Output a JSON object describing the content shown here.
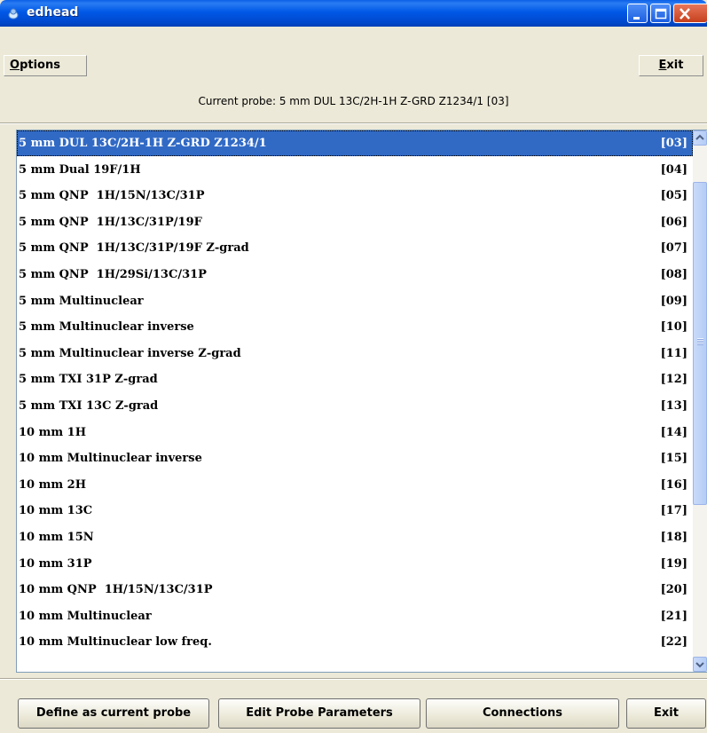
{
  "window": {
    "title": "edhead"
  },
  "menu": {
    "options_label": "Options",
    "exit_label": "Exit"
  },
  "info": {
    "current_probe_text": "Current probe: 5 mm DUL 13C/2H-1H Z-GRD Z1234/1 [03]"
  },
  "list": {
    "selected_index": 0,
    "items": [
      {
        "label": "5 mm DUL 13C/2H-1H Z-GRD Z1234/1",
        "code": "[03]"
      },
      {
        "label": "5 mm Dual 19F/1H",
        "code": "[04]"
      },
      {
        "label": "5 mm QNP  1H/15N/13C/31P",
        "code": "[05]"
      },
      {
        "label": "5 mm QNP  1H/13C/31P/19F",
        "code": "[06]"
      },
      {
        "label": "5 mm QNP  1H/13C/31P/19F Z-grad",
        "code": "[07]"
      },
      {
        "label": "5 mm QNP  1H/29Si/13C/31P",
        "code": "[08]"
      },
      {
        "label": "5 mm Multinuclear",
        "code": "[09]"
      },
      {
        "label": "5 mm Multinuclear inverse",
        "code": "[10]"
      },
      {
        "label": "5 mm Multinuclear inverse Z-grad",
        "code": "[11]"
      },
      {
        "label": "5 mm TXI 31P Z-grad",
        "code": "[12]"
      },
      {
        "label": "5 mm TXI 13C Z-grad",
        "code": "[13]"
      },
      {
        "label": "10 mm 1H",
        "code": "[14]"
      },
      {
        "label": "10 mm Multinuclear inverse",
        "code": "[15]"
      },
      {
        "label": "10 mm 2H",
        "code": "[16]"
      },
      {
        "label": "10 mm 13C",
        "code": "[17]"
      },
      {
        "label": "10 mm 15N",
        "code": "[18]"
      },
      {
        "label": "10 mm 31P",
        "code": "[19]"
      },
      {
        "label": "10 mm QNP  1H/15N/13C/31P",
        "code": "[20]"
      },
      {
        "label": "10 mm Multinuclear",
        "code": "[21]"
      },
      {
        "label": "10 mm Multinuclear low freq.",
        "code": "[22]"
      }
    ]
  },
  "buttons": {
    "define": "Define as current probe",
    "edit": "Edit Probe Parameters",
    "connections": "Connections",
    "exit": "Exit"
  },
  "colors": {
    "titlebar": "#0058e6",
    "selection": "#316ac5",
    "window_bg": "#ece9d8"
  }
}
